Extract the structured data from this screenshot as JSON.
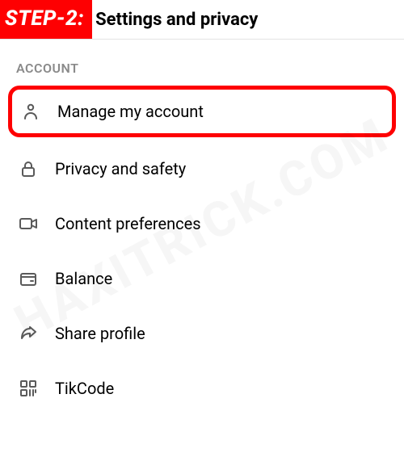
{
  "step_badge": "STEP-2:",
  "header": {
    "title": "Settings and privacy"
  },
  "section_label": "ACCOUNT",
  "menu": {
    "items": [
      {
        "label": "Manage my account",
        "highlighted": true
      },
      {
        "label": "Privacy and safety",
        "highlighted": false
      },
      {
        "label": "Content preferences",
        "highlighted": false
      },
      {
        "label": "Balance",
        "highlighted": false
      },
      {
        "label": "Share profile",
        "highlighted": false
      },
      {
        "label": "TikCode",
        "highlighted": false
      }
    ]
  },
  "watermark": "HAXITRICK.COM",
  "colors": {
    "accent": "#fe0002"
  }
}
